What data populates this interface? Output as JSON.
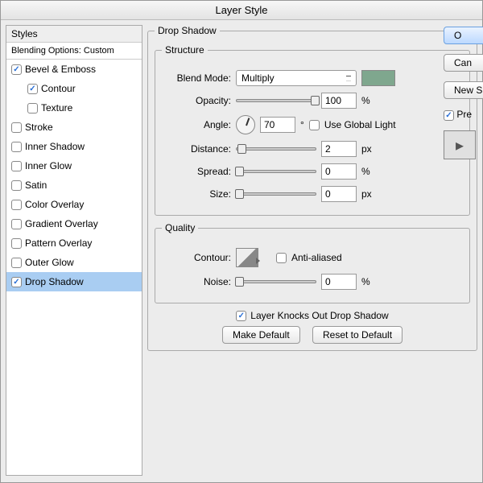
{
  "window": {
    "title": "Layer Style"
  },
  "sidebar": {
    "header": "Styles",
    "blending": "Blending Options: Custom",
    "items": [
      {
        "label": "Bevel & Emboss",
        "checked": true,
        "sub": false
      },
      {
        "label": "Contour",
        "checked": true,
        "sub": true
      },
      {
        "label": "Texture",
        "checked": false,
        "sub": true
      },
      {
        "label": "Stroke",
        "checked": false,
        "sub": false
      },
      {
        "label": "Inner Shadow",
        "checked": false,
        "sub": false
      },
      {
        "label": "Inner Glow",
        "checked": false,
        "sub": false
      },
      {
        "label": "Satin",
        "checked": false,
        "sub": false
      },
      {
        "label": "Color Overlay",
        "checked": false,
        "sub": false
      },
      {
        "label": "Gradient Overlay",
        "checked": false,
        "sub": false
      },
      {
        "label": "Pattern Overlay",
        "checked": false,
        "sub": false
      },
      {
        "label": "Outer Glow",
        "checked": false,
        "sub": false
      },
      {
        "label": "Drop Shadow",
        "checked": true,
        "sub": false,
        "selected": true
      }
    ]
  },
  "panel": {
    "title": "Drop Shadow",
    "structure": {
      "legend": "Structure",
      "blend_mode": {
        "label": "Blend Mode:",
        "value": "Multiply"
      },
      "color_swatch": "#7fa78e",
      "opacity": {
        "label": "Opacity:",
        "value": "100",
        "unit": "%"
      },
      "angle": {
        "label": "Angle:",
        "value": "70",
        "unit": "°",
        "global_label": "Use Global Light",
        "global_checked": false
      },
      "distance": {
        "label": "Distance:",
        "value": "2",
        "unit": "px"
      },
      "spread": {
        "label": "Spread:",
        "value": "0",
        "unit": "%"
      },
      "size": {
        "label": "Size:",
        "value": "0",
        "unit": "px"
      }
    },
    "quality": {
      "legend": "Quality",
      "contour": {
        "label": "Contour:",
        "antialias_label": "Anti-aliased",
        "antialias_checked": false
      },
      "noise": {
        "label": "Noise:",
        "value": "0",
        "unit": "%"
      }
    },
    "knocks": {
      "label": "Layer Knocks Out Drop Shadow",
      "checked": true
    },
    "make_default": "Make Default",
    "reset_default": "Reset to Default"
  },
  "right": {
    "ok": "O",
    "cancel": "Can",
    "new_style": "New S",
    "preview_label": "Pre",
    "preview_checked": true
  }
}
